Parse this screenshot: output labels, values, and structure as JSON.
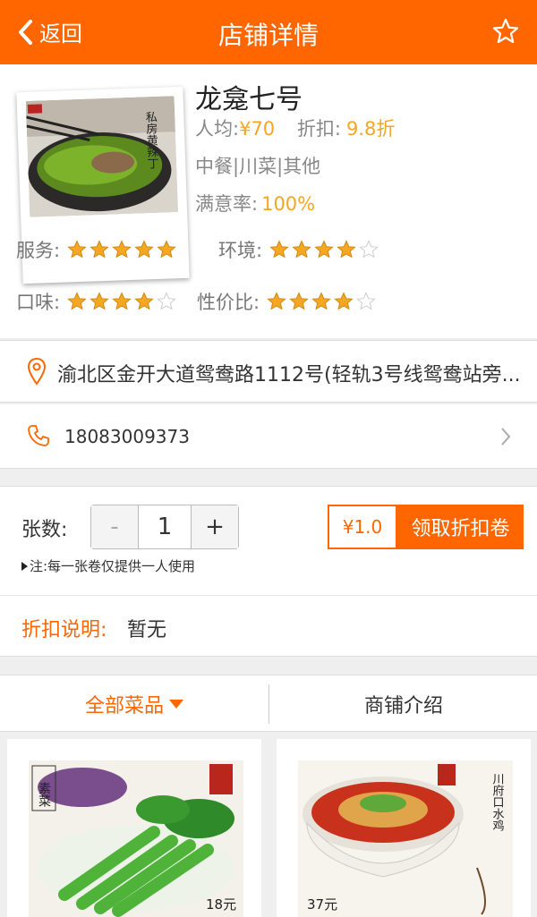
{
  "header": {
    "back_label": "返回",
    "title": "店铺详情",
    "icon": "star-outline-icon"
  },
  "shop": {
    "name": "龙龛七号",
    "thumb_text": "私房黄辣丁",
    "avg_label": "人均:",
    "avg_value": "¥70",
    "discount_label": "折扣:",
    "discount_value": "9.8折",
    "categories": "中餐|川菜|其他",
    "satisfaction_label": "满意率:",
    "satisfaction_value": "100%"
  },
  "ratings": [
    {
      "label": "服务:",
      "stars": 5
    },
    {
      "label": "环境:",
      "stars": 4
    },
    {
      "label": "口味:",
      "stars": 4
    },
    {
      "label": "性价比:",
      "stars": 4
    }
  ],
  "address": "渝北区金开大道鸳鸯路1112号(轻轨3号线鸳鸯站旁...",
  "phone": "18083009373",
  "coupon": {
    "qty_label": "张数:",
    "minus": "-",
    "qty": "1",
    "plus": "+",
    "price": "¥1.0",
    "get_label": "领取折扣卷",
    "note": "注:每一张卷仅提供一人使用"
  },
  "discount_desc": {
    "label": "折扣说明:",
    "value": "暂无"
  },
  "tabs": {
    "all_dishes": "全部菜品",
    "shop_intro": "商铺介绍"
  },
  "dishes": [
    {
      "stamp": "素菜",
      "price": "18元"
    },
    {
      "stamp": "川府口水鸡",
      "price": "37元"
    }
  ],
  "colors": {
    "accent": "#ff6600",
    "star": "#f5a623"
  }
}
